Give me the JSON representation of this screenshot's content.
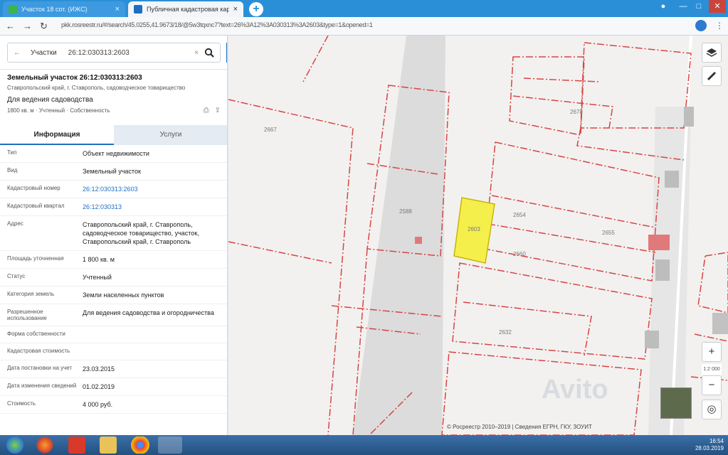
{
  "browser": {
    "tabs": [
      {
        "title": "Участок 18 сот. (ИЖС)",
        "favicon_color": "#3ab54a",
        "close": "×"
      },
      {
        "title": "Публичная кадастровая карта",
        "favicon_color": "#1e6fc0",
        "close": "×"
      }
    ],
    "new_tab": "+",
    "window_buttons": {
      "profile": "●",
      "minimize": "—",
      "maximize": "□",
      "close": "✕"
    },
    "nav": {
      "back": "←",
      "forward": "→",
      "reload": "↻"
    },
    "url": "pkk.rosreestr.ru/#/search/45.0255,41.9673/18/@5w3tqxnc7?text=26%3A12%3A030313%3A2603&type=1&opened=1"
  },
  "panel": {
    "search": {
      "type": "Участки",
      "value": "26:12:030313:2603",
      "clear": "×",
      "collapse": "‹"
    },
    "header": {
      "title": "Земельный участок 26:12:030313:2603",
      "address": "Ставропольский край, г. Ставрополь, садоводческое товарищество",
      "type": "Для ведения садоводства",
      "meta": "1800 кв. м · Учтенный · Собственность"
    },
    "tabs": [
      {
        "label": "Информация",
        "active": true
      },
      {
        "label": "Услуги",
        "active": false
      }
    ],
    "rows": [
      {
        "key": "Тип",
        "value": "Объект недвижимости",
        "link": false
      },
      {
        "key": "Вид",
        "value": "Земельный участок",
        "link": false
      },
      {
        "key": "Кадастровый номер",
        "value": "26:12:030313:2603",
        "link": true
      },
      {
        "key": "Кадастровый квартал",
        "value": "26:12:030313",
        "link": true
      },
      {
        "key": "Адрес",
        "value": "Ставропольский край, г. Ставрополь, садоводческое товарищество, участок, Ставропольский край, г. Ставрополь",
        "link": false
      },
      {
        "key": "Площадь уточненная",
        "value": "1 800 кв. м",
        "link": false
      },
      {
        "key": "Статус",
        "value": "Учтенный",
        "link": false
      },
      {
        "key": "Категория земель",
        "value": "Земли населенных пунктов",
        "link": false
      },
      {
        "key": "Разрешенное использование",
        "value": "Для ведения садоводства и огородничества",
        "link": false
      },
      {
        "key": "Форма собственности",
        "value": "",
        "link": false
      },
      {
        "key": "Кадастровая стоимость",
        "value": "",
        "link": false
      },
      {
        "key": "Дата постановки на учет",
        "value": "23.03.2015",
        "link": false
      },
      {
        "key": "Дата изменения сведений",
        "value": "01.02.2019",
        "link": false
      },
      {
        "key": "Стоимость",
        "value": "4 000 руб.",
        "link": false
      }
    ]
  },
  "map": {
    "labels": [
      {
        "text": "2603"
      },
      {
        "text": "2654"
      },
      {
        "text": "2655"
      },
      {
        "text": "2632"
      },
      {
        "text": "2660"
      },
      {
        "text": "2588"
      },
      {
        "text": "2678"
      },
      {
        "text": "2667"
      }
    ],
    "controls": {
      "layers": "layers-icon",
      "measure": "ruler-icon",
      "zoom_in": "+",
      "zoom_out": "−",
      "locate": "◎",
      "zoom_level": "1:2 000"
    },
    "attribution": "© Росреестр 2010–2019 | Сведения ЕГРН, ГКУ, ЗОУИТ",
    "watermark": "Avito",
    "highlight_color": "#f5ef4b",
    "boundary_color": "#d64545"
  },
  "taskbar": {
    "items": [
      "start",
      "firefox",
      "pdf",
      "explorer",
      "chrome",
      "app"
    ],
    "clock": "16:54",
    "date": "28.03.2019"
  }
}
